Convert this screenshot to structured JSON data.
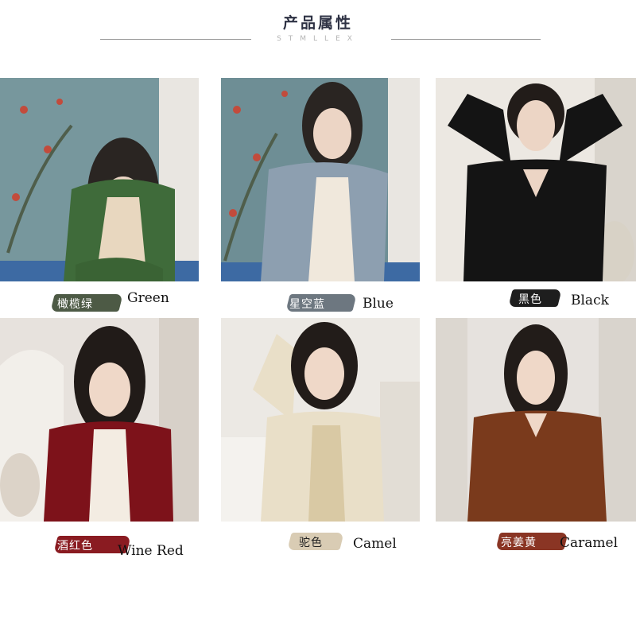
{
  "header": {
    "title": "产品属性",
    "subtitle": "STMLLEX"
  },
  "colors": [
    {
      "cn": "橄榄绿",
      "en": "Green",
      "hex": "#3f6b3a",
      "swatch": "#4d5a45",
      "bg": "#5f7f86"
    },
    {
      "cn": "星空蓝",
      "en": "Blue",
      "hex": "#8d9fb0",
      "swatch": "#6d7780",
      "bg": "#5f7f86"
    },
    {
      "cn": "黑色",
      "en": "Black",
      "hex": "#141414",
      "swatch": "#1e1e1e",
      "bg": "#ece8e2"
    },
    {
      "cn": "酒红色",
      "en": "Wine Red",
      "hex": "#7d121a",
      "swatch": "#8a1b21",
      "bg": "#e7e2dd"
    },
    {
      "cn": "驼色",
      "en": "Camel",
      "hex": "#e9dfc8",
      "swatch": "#d9ccb4",
      "bg": "#ece9e4"
    },
    {
      "cn": "亮姜黄",
      "en": "Caramel",
      "hex": "#7a3a1c",
      "swatch": "#8a3524",
      "bg": "#e6e2de"
    }
  ]
}
